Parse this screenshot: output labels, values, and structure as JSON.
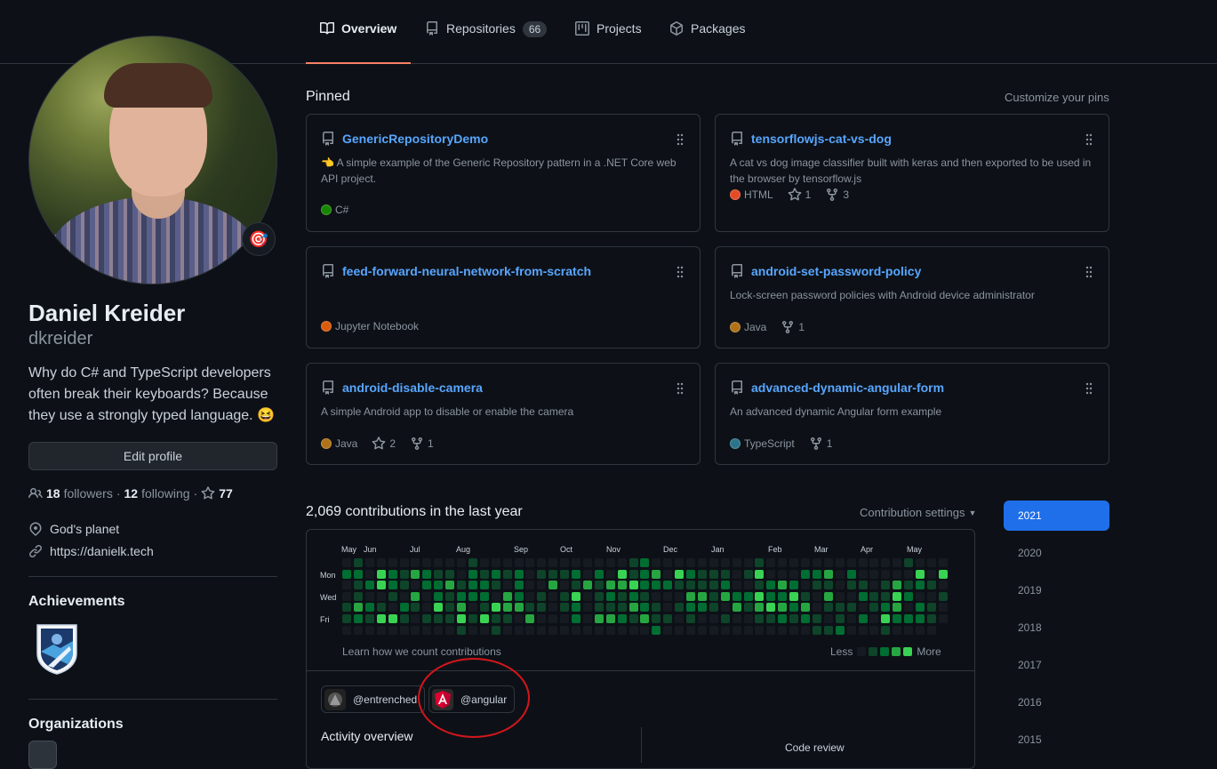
{
  "nav": {
    "tabs": [
      {
        "label": "Overview",
        "icon": "book-icon",
        "active": true
      },
      {
        "label": "Repositories",
        "icon": "repo-icon",
        "count": "66"
      },
      {
        "label": "Projects",
        "icon": "project-icon"
      },
      {
        "label": "Packages",
        "icon": "package-icon"
      }
    ]
  },
  "profile": {
    "status_emoji": "🎯",
    "name": "Daniel Kreider",
    "login": "dkreider",
    "bio": "Why do C# and TypeScript developers often break their keyboards? Because they use a strongly typed language. 😆",
    "edit_label": "Edit profile",
    "followers": "18",
    "followers_label": "followers",
    "following": "12",
    "following_label": "following",
    "stars": "77",
    "location": "God's planet",
    "website": "https://danielk.tech",
    "achievements_title": "Achievements",
    "organizations_title": "Organizations"
  },
  "pinned": {
    "title": "Pinned",
    "customize": "Customize your pins",
    "repos": [
      {
        "name": "GenericRepositoryDemo",
        "desc": "👈 A simple example of the Generic Repository pattern in a .NET Core web API project.",
        "lang": "C#",
        "color": "#178600"
      },
      {
        "name": "tensorflowjs-cat-vs-dog",
        "desc": "A cat vs dog image classifier built with keras and then exported to be used in the browser by tensorflow.js",
        "lang": "HTML",
        "color": "#e34c26",
        "stars": "1",
        "forks": "3"
      },
      {
        "name": "feed-forward-neural-network-from-scratch",
        "desc": "",
        "lang": "Jupyter Notebook",
        "color": "#DA5B0B"
      },
      {
        "name": "android-set-password-policy",
        "desc": "Lock-screen password policies with Android device administrator",
        "lang": "Java",
        "color": "#b07219",
        "forks": "1"
      },
      {
        "name": "android-disable-camera",
        "desc": "A simple Android app to disable or enable the camera",
        "lang": "Java",
        "color": "#b07219",
        "stars": "2",
        "forks": "1"
      },
      {
        "name": "advanced-dynamic-angular-form",
        "desc": "An advanced dynamic Angular form example",
        "lang": "TypeScript",
        "color": "#2b7489",
        "forks": "1"
      }
    ]
  },
  "contributions": {
    "heading": "2,069 contributions in the last year",
    "settings_label": "Contribution settings",
    "months": [
      "May",
      "Jun",
      "Jul",
      "Aug",
      "Sep",
      "Oct",
      "Nov",
      "Dec",
      "Jan",
      "Feb",
      "Mar",
      "Apr",
      "May"
    ],
    "day_labels": [
      "Mon",
      "Wed",
      "Fri"
    ],
    "learn_label": "Learn how we count contributions",
    "less_label": "Less",
    "more_label": "More",
    "level_colors": [
      "#161b22",
      "#0e4429",
      "#006d32",
      "#26a641",
      "#39d353"
    ],
    "orgs": [
      {
        "label": "@entrenched",
        "icon": "entrenched-org-icon"
      },
      {
        "label": "@angular",
        "icon": "angular-org-icon"
      }
    ],
    "activity_title": "Activity overview",
    "code_review_label": "Code review"
  },
  "years": [
    "2021",
    "2020",
    "2019",
    "2018",
    "2017",
    "2016",
    "2015"
  ],
  "highlight_color": "#d3161c"
}
